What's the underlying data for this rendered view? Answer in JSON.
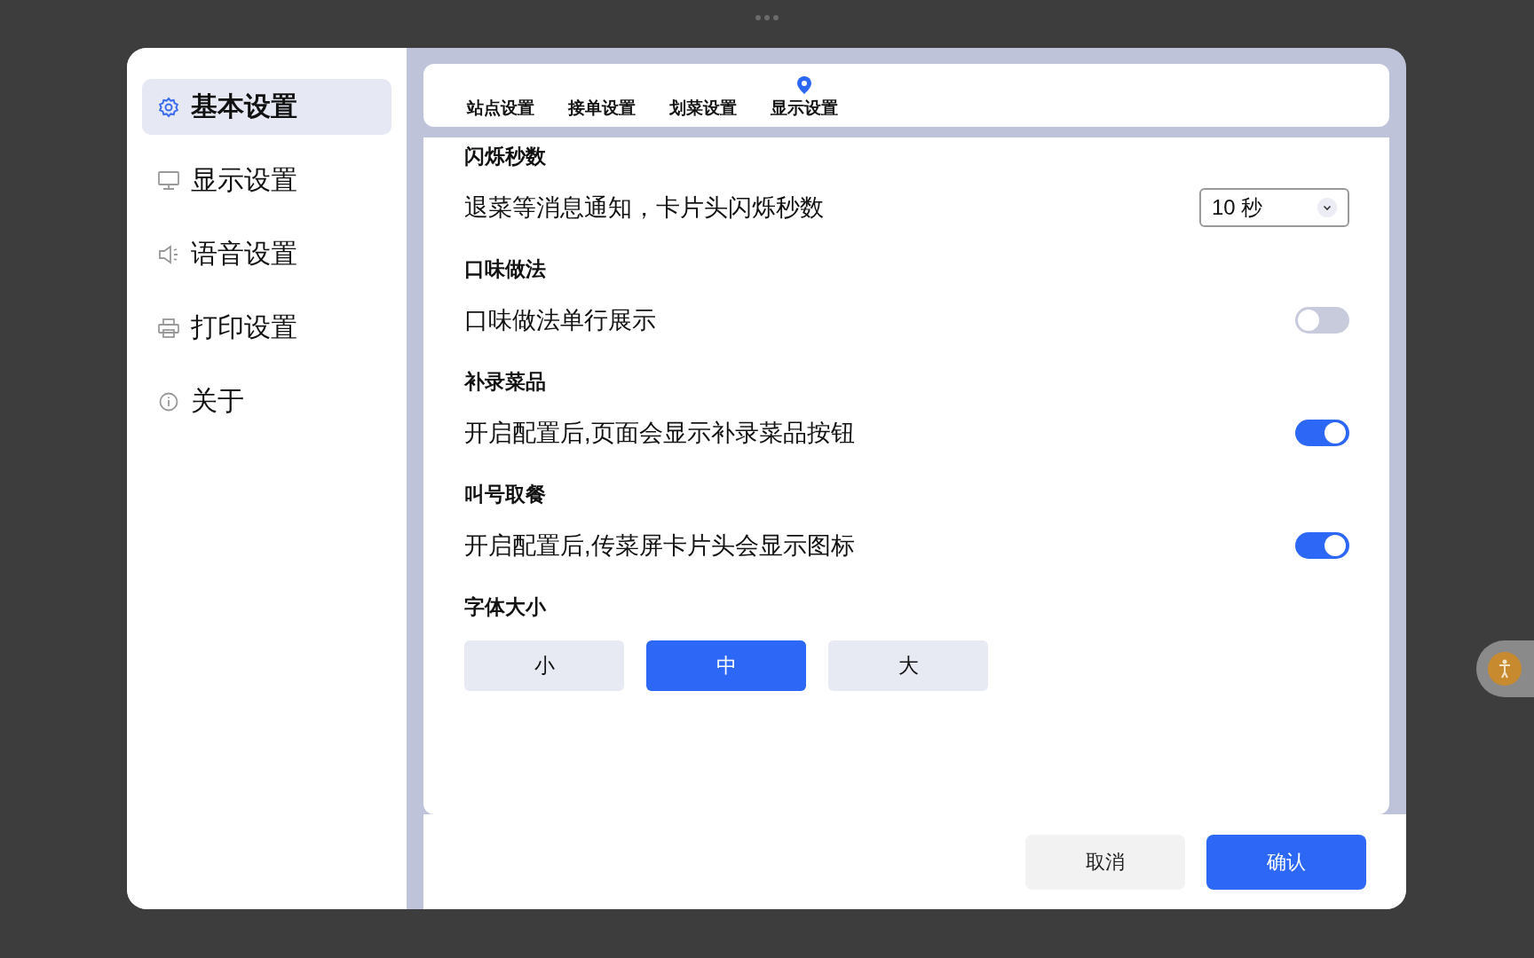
{
  "sidebar": {
    "items": [
      {
        "label": "基本设置",
        "selected": true
      },
      {
        "label": "显示设置",
        "selected": false
      },
      {
        "label": "语音设置",
        "selected": false
      },
      {
        "label": "打印设置",
        "selected": false
      },
      {
        "label": "关于",
        "selected": false
      }
    ]
  },
  "tabs": [
    {
      "label": "站点设置",
      "selected": false
    },
    {
      "label": "接单设置",
      "selected": false
    },
    {
      "label": "划菜设置",
      "selected": false
    },
    {
      "label": "显示设置",
      "selected": true
    }
  ],
  "sections": [
    {
      "title": "闪烁秒数",
      "kind": "select",
      "label": "退菜等消息通知，卡片头闪烁秒数",
      "value": "10 秒"
    },
    {
      "title": "口味做法",
      "kind": "toggle",
      "label": "口味做法单行展示",
      "on": false
    },
    {
      "title": "补录菜品",
      "kind": "toggle",
      "label": "开启配置后,页面会显示补录菜品按钮",
      "on": true
    },
    {
      "title": "叫号取餐",
      "kind": "toggle",
      "label": "开启配置后,传菜屏卡片头会显示图标",
      "on": true
    },
    {
      "title": "字体大小",
      "kind": "segmented",
      "options": [
        {
          "label": "小",
          "selected": false
        },
        {
          "label": "中",
          "selected": true
        },
        {
          "label": "大",
          "selected": false
        }
      ]
    }
  ],
  "footer": {
    "buttons": [
      {
        "label": "取消",
        "kind": "secondary"
      },
      {
        "label": "确认",
        "kind": "primary"
      }
    ]
  }
}
